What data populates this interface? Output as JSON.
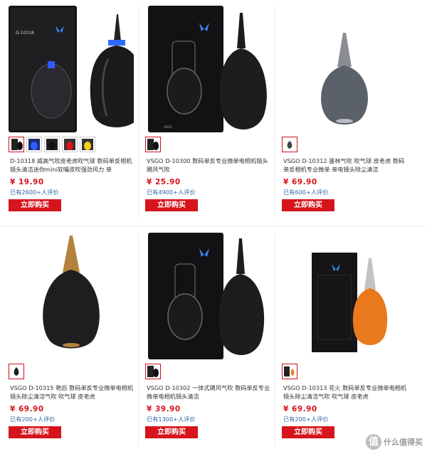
{
  "products": [
    {
      "description": "D-10318 威高气吹皮老虎吹气球 数码单反相机镜头清洁迷你mini软嘴皮吹强劲风力 单",
      "price": "¥ 19.90",
      "reviews": "已有2600+人评价",
      "buy_label": "立即购买",
      "thumb_count": 5
    },
    {
      "description": "VSGO D-10300 数码单反专业微单电相机镜头飓风气吹",
      "price": "¥ 25.90",
      "reviews": "已有4900+人评价",
      "buy_label": "立即购买",
      "thumb_count": 1
    },
    {
      "description": "VSGO D-10312 墨林气吹 吹气球 皮老虎 数码单反相机专业微单 单电镜头除尘清洁",
      "price": "¥ 69.90",
      "reviews": "已有600+人评价",
      "buy_label": "立即购买",
      "thumb_count": 1
    },
    {
      "description": "VSGO D-10315 艳后 数码单反专业微单电相机镜头除尘清洁气吹 吹气球 皮老虎",
      "price": "¥ 69.90",
      "reviews": "已有200+人评价",
      "buy_label": "立即购买",
      "thumb_count": 1
    },
    {
      "description": "VSGO D-10302 一体式飓风气吹 数码单反专业微单电相机镜头清洁",
      "price": "¥ 39.90",
      "reviews": "已有1300+人评价",
      "buy_label": "立即购买",
      "thumb_count": 1
    },
    {
      "description": "VSGO D-10313 花火 数码单反专业微单电相机镜头除尘清洁气吹 吹气球 皮老虎",
      "price": "¥ 69.90",
      "reviews": "已有200+人评价",
      "buy_label": "立即购买",
      "thumb_count": 1
    }
  ],
  "package_label_1": "D-10318",
  "watermark": {
    "icon_glyph": "值",
    "text": "什么值得买"
  },
  "colors": {
    "price_red": "#d7141d",
    "button_red": "#d5141c",
    "review_blue": "#3466a5",
    "blower_black": "#1d1d1f",
    "blower_gray": "#5b6168",
    "blower_orange": "#e8791d"
  }
}
